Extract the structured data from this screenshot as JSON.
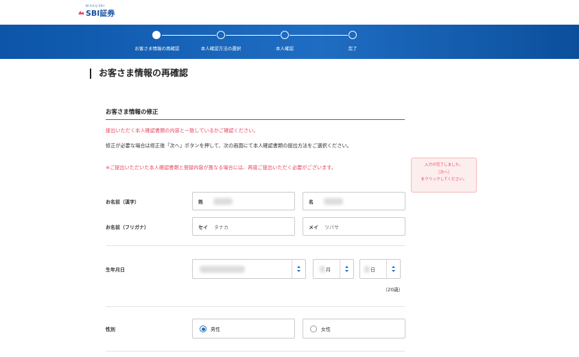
{
  "header": {
    "logo_tagline": "NISAもSBI",
    "logo_text": "SBI証券"
  },
  "steps": [
    {
      "label": "お客さま情報の再確認",
      "active": true
    },
    {
      "label": "本人確認方法の選択",
      "active": false
    },
    {
      "label": "本人確認",
      "active": false
    },
    {
      "label": "完了",
      "active": false
    }
  ],
  "page": {
    "title": "お客さま情報の再確認"
  },
  "section": {
    "title": "お客さま情報の修正",
    "message_check": "提出いただく本人確認書類の内容と一致しているかご確認ください。",
    "message_edit": "修正が必要な場合は修正後「次へ」ボタンを押して、次の画面にて本人確認書類の提出方法をご選択ください。",
    "message_warning": "※ご提出いただいた本人確認書類と登録内容が異なる場合には、再度ご提出いただく必要がございます。"
  },
  "tooltip": {
    "line1": "入力が完了しました。",
    "line2": "［次へ］",
    "line3": "をクリックしてください。"
  },
  "form": {
    "name_kanji": {
      "label": "お名前（漢字）",
      "last_prefix": "姓",
      "first_prefix": "名"
    },
    "name_kana": {
      "label": "お名前（フリガナ）",
      "last_prefix": "セイ",
      "last_value": "タナカ",
      "first_prefix": "メイ",
      "first_value": "ツバサ"
    },
    "birthdate": {
      "label": "生年月日",
      "month": "月",
      "day": "日",
      "age": "（20歳）"
    },
    "gender": {
      "label": "性別",
      "options": [
        {
          "label": "男性",
          "checked": true
        },
        {
          "label": "女性",
          "checked": false
        }
      ]
    }
  },
  "colors": {
    "brand_blue": "#1f6dc3",
    "warning_red": "#e94560"
  }
}
